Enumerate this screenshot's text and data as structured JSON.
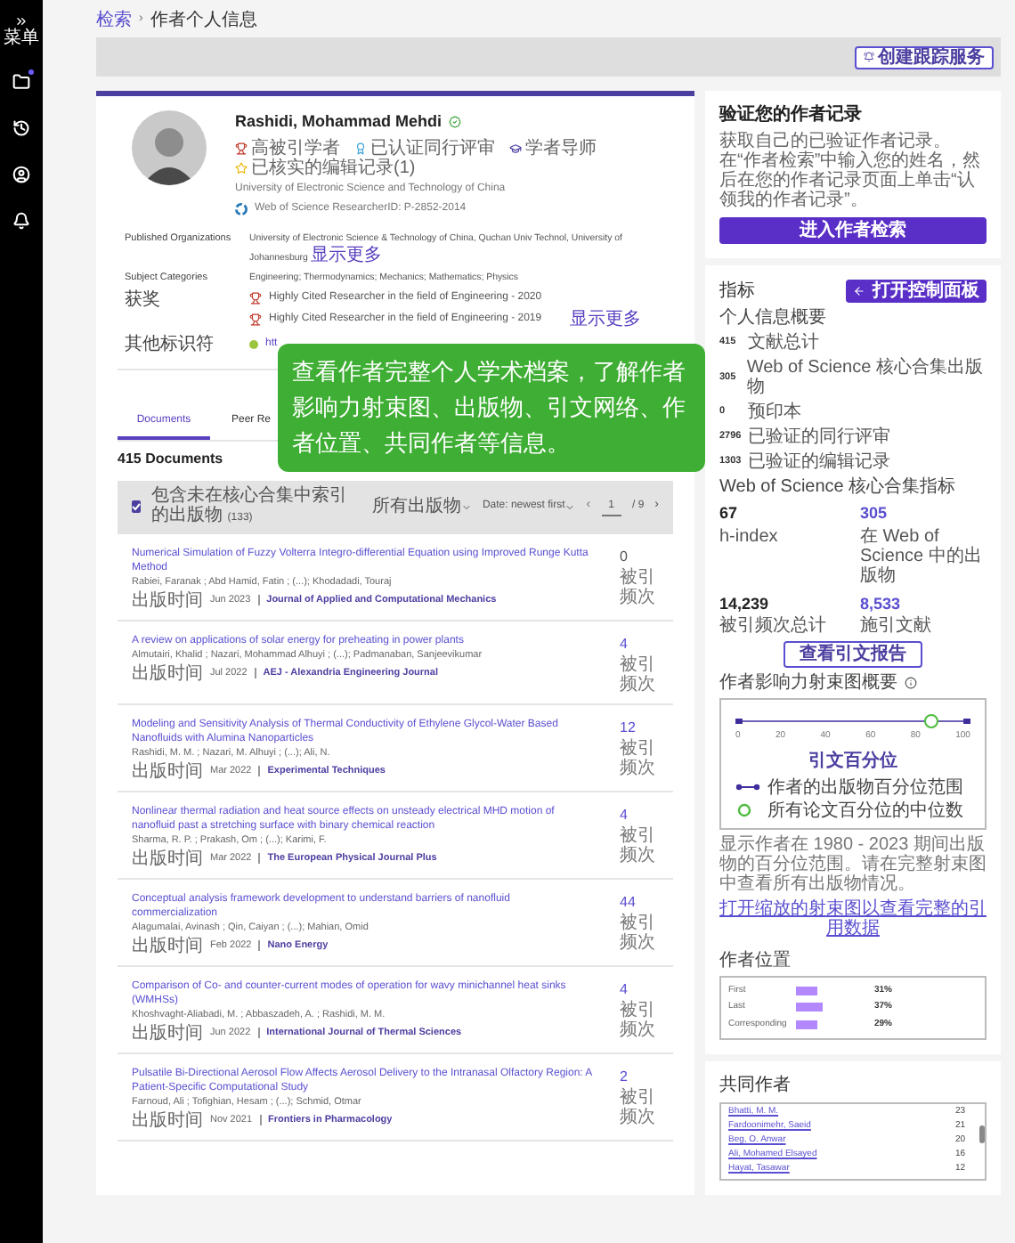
{
  "sidebar": {
    "menu_label": "菜单",
    "items": [
      {
        "kind": "folder",
        "badge": true
      },
      {
        "kind": "history",
        "badge": false
      },
      {
        "kind": "user",
        "badge": false
      },
      {
        "kind": "bell",
        "badge": false
      }
    ]
  },
  "breadcrumb": {
    "link": "检索",
    "separator": "›",
    "current": "作者个人信息"
  },
  "track_button": "创建跟踪服务",
  "profile": {
    "name": "Rashidi, Mohammad Mehdi",
    "verified": true,
    "badges": [
      {
        "kind": "trophy",
        "label": "高被引学者"
      },
      {
        "kind": "reviewer",
        "label": "已认证同行评审"
      },
      {
        "kind": "mentor",
        "label": "学者导师"
      },
      {
        "kind": "star",
        "label": "已核实的编辑记录(1)"
      }
    ],
    "affiliation": "University of Electronic Science and Technology of China",
    "researcher_id": "Web of Science ResearcherID: P-2852-2014",
    "rows": [
      {
        "kind": "text",
        "label": "Published Organizations",
        "value": "University of Electronic Science & Technology of China, Quchan Univ Technol, University of Johannesburg",
        "more": "显示更多"
      },
      {
        "kind": "text",
        "label": "Subject Categories",
        "value": "Engineering; Thermodynamics; Mechanics; Mathematics; Physics"
      },
      {
        "kind": "awards",
        "label": "获奖",
        "items": [
          "Highly Cited Researcher in the field of Engineering - 2020",
          "Highly Cited Researcher in the field of Engineering - 2019"
        ],
        "more": "显示更多"
      },
      {
        "kind": "identifier",
        "label": "其他标识符",
        "value": "htt"
      }
    ]
  },
  "overlay": "查看作者完整个人学术档案，了解作者影响力射束图、出版物、引文网络、作者位置、共同作者等信息。",
  "tabs": [
    {
      "label": "Documents",
      "selected": true
    },
    {
      "label": "Peer Re",
      "selected": false
    }
  ],
  "documents": {
    "count": "415 Documents",
    "filter": {
      "checked": true,
      "label": "包含未在核心合集中索引的出版物",
      "count": "(133)",
      "type": "所有出版物",
      "sort": "Date: newest first",
      "prev": "‹",
      "page": "1",
      "total": "/ 9",
      "next": "›"
    },
    "items": [
      {
        "title": "Numerical Simulation of Fuzzy Volterra Integro-differential Equation using Improved Runge Kutta Method",
        "authors": "Rabiei, Faranak ; Abd Hamid, Fatin ; (...); Khodadadi, Touraj",
        "date_label": "出版时间",
        "date": "Jun 2023",
        "journal": "Journal of Applied and Computational Mechanics",
        "cites": "0",
        "cites_label": "被引频次"
      },
      {
        "title": "A review on applications of solar energy for preheating in power plants",
        "authors": "Almutairi, Khalid ; Nazari, Mohammad Alhuyi ; (...); Padmanaban, Sanjeevikumar",
        "date_label": "出版时间",
        "date": "Jul 2022",
        "journal": "AEJ - Alexandria Engineering Journal",
        "cites": "4",
        "cites_label": "被引频次"
      },
      {
        "title": "Modeling and Sensitivity Analysis of Thermal Conductivity of Ethylene Glycol-Water Based Nanofluids with Alumina Nanoparticles",
        "authors": "Rashidi, M. M. ; Nazari, M. Alhuyi ; (...); Ali, N.",
        "date_label": "出版时间",
        "date": "Mar 2022",
        "journal": "Experimental Techniques",
        "cites": "12",
        "cites_label": "被引频次"
      },
      {
        "title": "Nonlinear thermal radiation and heat source effects on unsteady electrical MHD motion of nanofluid past a stretching surface with binary chemical reaction",
        "authors": "Sharma, R. P. ; Prakash, Om ; (...); Karimi, F.",
        "date_label": "出版时间",
        "date": "Mar 2022",
        "journal": "The European Physical Journal Plus",
        "cites": "4",
        "cites_label": "被引频次"
      },
      {
        "title": "Conceptual analysis framework development to understand barriers of nanofluid commercialization",
        "authors": "Alagumalai, Avinash ; Qin, Caiyan ; (...); Mahian, Omid",
        "date_label": "出版时间",
        "date": "Feb 2022",
        "journal": "Nano Energy",
        "cites": "44",
        "cites_label": "被引频次"
      },
      {
        "title": "Comparison of Co- and counter-current modes of operation for wavy minichannel heat sinks (WMHSs)",
        "authors": "Khoshvaght-Aliabadi, M. ; Abbaszadeh, A. ; Rashidi, M. M.",
        "date_label": "出版时间",
        "date": "Jun 2022",
        "journal": "International Journal of Thermal Sciences",
        "cites": "4",
        "cites_label": "被引频次"
      },
      {
        "title": "Pulsatile Bi-Directional Aerosol Flow Affects Aerosol Delivery to the Intranasal Olfactory Region: A Patient-Specific Computational Study",
        "authors": "Farnoud, Ali ; Tofighian, Hesam ; (...); Schmid, Otmar",
        "date_label": "出版时间",
        "date": "Nov 2021",
        "journal": "Frontiers in Pharmacology",
        "cites": "2",
        "cites_label": "被引频次"
      }
    ]
  },
  "verify": {
    "title": "验证您的作者记录",
    "text": "获取自己的已验证作者记录。在“作者检索”中输入您的姓名，然后在您的作者记录页面上单击“认领我的作者记录”。",
    "button": "进入作者检索"
  },
  "metrics": {
    "title": "指标",
    "dashboard_button": "打开控制面板",
    "summary_title": "个人信息概要",
    "summary": [
      {
        "value": "415",
        "label": "文献总计"
      },
      {
        "value": "305",
        "label": "Web of Science 核心合集出版物"
      },
      {
        "value": "0",
        "label": "预印本"
      },
      {
        "value": "2796",
        "label": "已验证的同行评审"
      },
      {
        "value": "1303",
        "label": "已验证的编辑记录"
      }
    ],
    "core_title": "Web of Science 核心合集指标",
    "core": [
      {
        "value": "67",
        "label": "h-index",
        "link": false
      },
      {
        "value": "305",
        "label": "在 Web of Science 中的出版物",
        "link": true
      },
      {
        "value": "14,239",
        "label": "被引频次总计",
        "link": false
      },
      {
        "value": "8,533",
        "label": "施引文献",
        "link": true
      }
    ],
    "report_button": "查看引文报告",
    "beam_title": "作者影响力射束图概要",
    "beam": {
      "ticks": [
        "0",
        "20",
        "40",
        "60",
        "80",
        "100"
      ],
      "axis_label": "引文百分位",
      "level": 0.83,
      "legend": [
        {
          "kind": "range",
          "label": "作者的出版物百分位范围"
        },
        {
          "kind": "median",
          "label": "所有论文百分位的中位数"
        }
      ]
    },
    "beam_note": "显示作者在 1980 - 2023 期间出版物的百分位范围。请在完整射束图中查看所有出版物情况。",
    "beam_link": "打开缩放的射束图以查看完整的引用数据",
    "position_title": "作者位置",
    "positions": [
      {
        "label": "First",
        "value": "31%",
        "level": 0.31
      },
      {
        "label": "Last",
        "value": "37%",
        "level": 0.37
      },
      {
        "label": "Corresponding",
        "value": "29%",
        "level": 0.29
      }
    ]
  },
  "coauthors": {
    "title": "共同作者",
    "items": [
      {
        "name": "Bhatti, M. M.",
        "count": "23"
      },
      {
        "name": "Fardoonimehr, Saeid",
        "count": "21"
      },
      {
        "name": "Beg, O. Anwar",
        "count": "20"
      },
      {
        "name": "Ali, Mohamed Elsayed",
        "count": "16"
      },
      {
        "name": "Hayat, Tasawar",
        "count": "12"
      }
    ]
  }
}
